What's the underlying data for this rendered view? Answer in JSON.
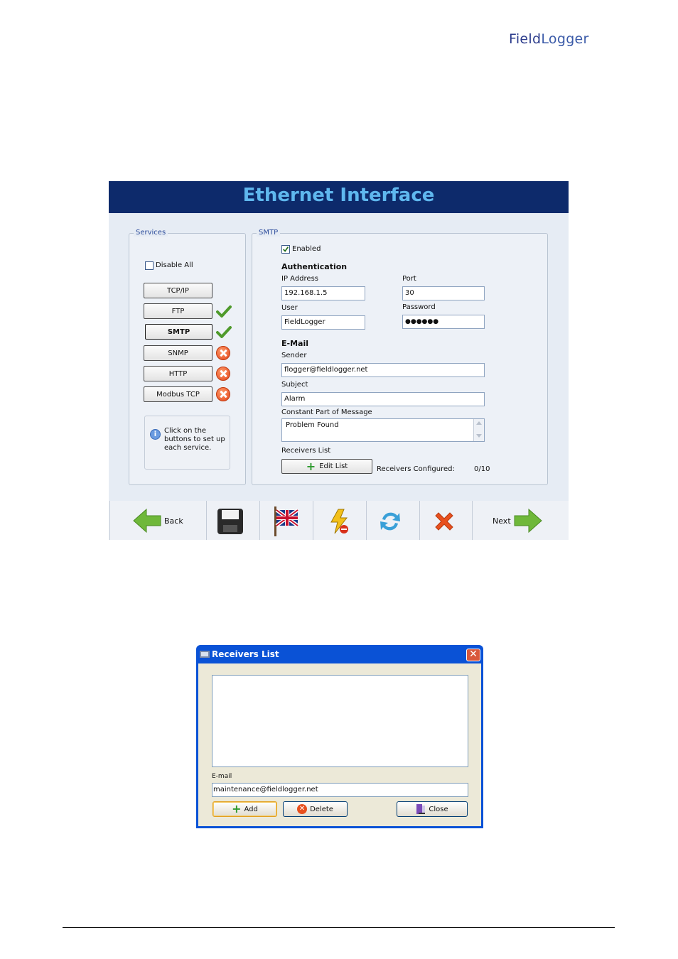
{
  "logo": {
    "part1": "Field",
    "part2": "Logger"
  },
  "window": {
    "title": "Ethernet Interface",
    "services": {
      "legend": "Services",
      "disable_all": "Disable All",
      "buttons": [
        {
          "label": "TCP/IP",
          "status": "none"
        },
        {
          "label": "FTP",
          "status": "ok"
        },
        {
          "label": "SMTP",
          "status": "ok"
        },
        {
          "label": "SNMP",
          "status": "error"
        },
        {
          "label": "HTTP",
          "status": "error"
        },
        {
          "label": "Modbus TCP",
          "status": "error"
        }
      ],
      "info": "Click on the buttons to set up each service."
    },
    "smtp": {
      "legend": "SMTP",
      "enabled_label": "Enabled",
      "enabled": true,
      "auth_heading": "Authentication",
      "ip_label": "IP Address",
      "ip_value": "192.168.1.5",
      "port_label": "Port",
      "port_value": "30",
      "user_label": "User",
      "user_value": "FieldLogger",
      "password_label": "Password",
      "password_value": "●●●●●●",
      "email_heading": "E-Mail",
      "sender_label": "Sender",
      "sender_value": "flogger@fieldlogger.net",
      "subject_label": "Subject",
      "subject_value": "Alarm",
      "message_label": "Constant Part of Message",
      "message_value": "Problem Found",
      "receivers_label": "Receivers List",
      "edit_list": "Edit List",
      "receivers_configured_label": "Receivers Configured:",
      "receivers_configured_value": "0/10"
    },
    "toolbar": {
      "back": "Back",
      "next": "Next"
    }
  },
  "dialog": {
    "title": "Receivers List",
    "email_label": "E-mail",
    "email_value": "maintenance@fieldlogger.net",
    "add": "Add",
    "delete": "Delete",
    "close": "Close"
  }
}
